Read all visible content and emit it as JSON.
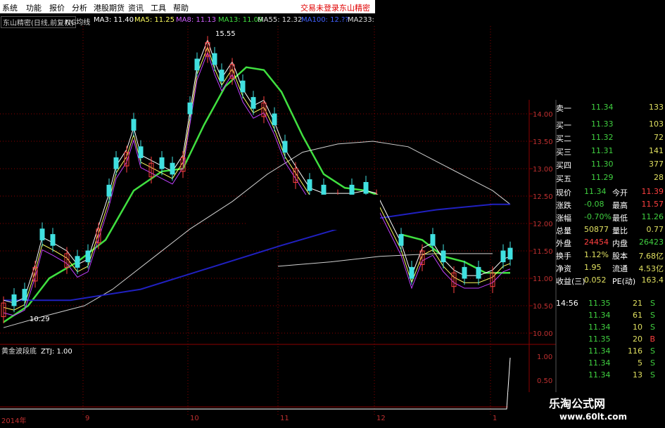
{
  "menu": {
    "items": [
      "系统",
      "功能",
      "报价",
      "分析",
      "港股期货",
      "资讯",
      "工具",
      "帮助"
    ],
    "right_items": [
      "交易未登录",
      "东山精密"
    ]
  },
  "ma_strip": {
    "stock": "东山精密(日线,前复权)",
    "indicator": "NG均线",
    "ma3": "MA3: 11.40",
    "ma5": "MA5: 11.25",
    "ma8": "MA8: 11.13",
    "ma13": "MA13: 11.09",
    "ma55": "MA55: 12.32",
    "ma100": "MA100: 12.??",
    "ma233": "MA233:"
  },
  "chart_annotations": {
    "high": "15.55",
    "low": "10.29"
  },
  "price_axis": [
    "14.00",
    "13.50",
    "13.00",
    "12.50",
    "12.00",
    "11.50",
    "11.00",
    "10.50",
    "10.00"
  ],
  "sub_panel": {
    "label": "黄金波段底",
    "value": "ZTJ: 1.00",
    "ticks": [
      "1.00",
      "0.50"
    ]
  },
  "dates": [
    "2014年",
    "9",
    "10",
    "11",
    "12",
    "1"
  ],
  "orderbook": [
    {
      "label": "卖一",
      "price": "11.34",
      "vol": "133"
    },
    {
      "label": "买一",
      "price": "11.33",
      "vol": "103"
    },
    {
      "label": "买二",
      "price": "11.32",
      "vol": "72"
    },
    {
      "label": "买三",
      "price": "11.31",
      "vol": "141"
    },
    {
      "label": "买四",
      "price": "11.30",
      "vol": "377"
    },
    {
      "label": "买五",
      "price": "11.29",
      "vol": "28"
    }
  ],
  "stats": [
    {
      "l1": "现价",
      "v1": "11.34",
      "l2": "今开",
      "v2": "11.39",
      "c1": "#40d040",
      "c2": "#ff4040"
    },
    {
      "l1": "涨跌",
      "v1": "-0.08",
      "l2": "最高",
      "v2": "11.57",
      "c1": "#40d040",
      "c2": "#ff4040"
    },
    {
      "l1": "涨幅",
      "v1": "-0.70%",
      "l2": "最低",
      "v2": "11.26",
      "c1": "#40d040",
      "c2": "#40d040"
    },
    {
      "l1": "总量",
      "v1": "50877",
      "l2": "量比",
      "v2": "0.77",
      "c1": "#e0e060",
      "c2": "#e0e060"
    },
    {
      "l1": "外盘",
      "v1": "24454",
      "l2": "内盘",
      "v2": "26423",
      "c1": "#ff4040",
      "c2": "#40d040"
    },
    {
      "l1": "换手",
      "v1": "1.12%",
      "l2": "股本",
      "v2": "7.68亿",
      "c1": "#e0e060",
      "c2": "#e0e060"
    },
    {
      "l1": "净资",
      "v1": "1.95",
      "l2": "流通",
      "v2": "4.53亿",
      "c1": "#e0e060",
      "c2": "#e0e060"
    },
    {
      "l1": "收益(三)",
      "v1": "0.052",
      "l2": "PE(动)",
      "v2": "163.4",
      "c1": "#e0e060",
      "c2": "#e0e060"
    }
  ],
  "ticks": [
    {
      "time": "14:56",
      "price": "11.35",
      "vol": "21",
      "side": "S"
    },
    {
      "time": "",
      "price": "11.34",
      "vol": "61",
      "side": "S"
    },
    {
      "time": "",
      "price": "11.34",
      "vol": "10",
      "side": "S"
    },
    {
      "time": "",
      "price": "11.35",
      "vol": "20",
      "side": "B"
    },
    {
      "time": "",
      "price": "11.34",
      "vol": "116",
      "side": "S"
    },
    {
      "time": "",
      "price": "11.34",
      "vol": "5",
      "side": "S"
    },
    {
      "time": "",
      "price": "11.34",
      "vol": "13",
      "side": "S"
    }
  ],
  "watermark": {
    "title": "乐淘公式网",
    "url": "www.60lt.com"
  },
  "colors": {
    "up": "#ff4040",
    "down": "#40e0e0",
    "ma13": "#40e040",
    "ma55": "#d0d0d0",
    "ma100": "#2020c0",
    "grid": "#8b0000"
  }
}
